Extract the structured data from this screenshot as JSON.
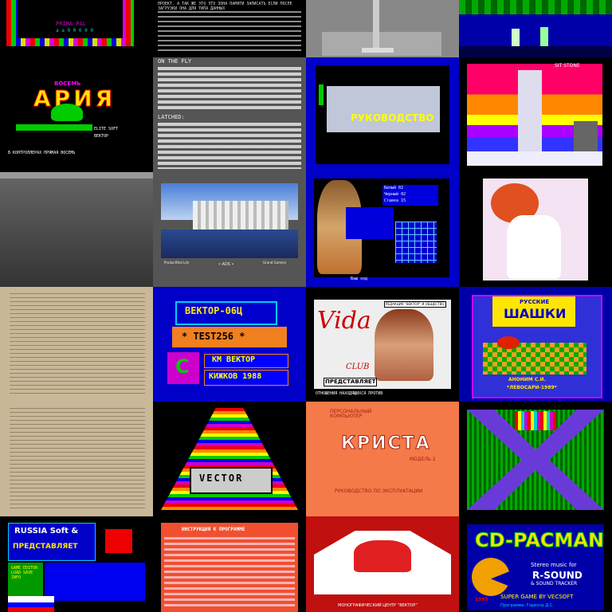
{
  "tiles": {
    "r0c0": {
      "line1": "PRIMA PAL",
      "line2": "a a 0 0 0 0 0"
    },
    "r0c1": {
      "text": "ПРОЕКТ. А ТАК ЖЕ ЭТО ЭТО ЗОНА ПАМЯТИ ЗАПИСАТЬ ЕСЛИ ПОСЛЕ ЗАГРУЗКИ ОНА ДЛЯ ТИПА ДАННЫХ"
    },
    "r1c0": {
      "top": "ВОСЕМЬ",
      "title": "АРИЯ",
      "sub1": "ELITE SOFT",
      "sub2": "ВЕКТОР",
      "bottom": "В КОНТРОЛЛЕРАХ ПРЯМАЯ ВОСЕМЬ"
    },
    "r1c1": {
      "header": "ON THE FLY",
      "latched": "LATCHED:"
    },
    "r1c2": {
      "caption": "РУКОВОДСТВО"
    },
    "r1c3": {
      "label": "SIT STONE"
    },
    "r2c2": {
      "score1": "Белый 02",
      "score2": "Черный 02",
      "score3": "Ставка 15",
      "footer": "Ваш ход"
    },
    "r2c1": {
      "credit1": "ProductRed Ldn",
      "credit2": "• ADS •",
      "credit3": "Grand Gamers"
    },
    "r3c1": {
      "title": "ВЕКТОР-06Ц",
      "test": "* TEST256 *",
      "logo": "С",
      "team": "KM ВЕКТОР",
      "year": "КИЖКОВ 1988"
    },
    "r3c2": {
      "brand": "Vida",
      "club": "CLUB",
      "box": "РЕДАКЦИЯ “ВЕКТОР” И ОБЩЕСТВО",
      "presents": "ПРЕДСТАВЛЯЕТ",
      "footer": "ОТНОШЕНИЯ НАХОДЯЩИХСЯ ПРОТИВ"
    },
    "r3c3": {
      "title1": "РУССКИЕ",
      "title2": "ШАШКИ",
      "author": "АНОНИМ С.И.",
      "year": "*ЛЕВОСАРИ-1989*"
    },
    "r4c1": {
      "label": "VECTOR"
    },
    "r4c2": {
      "top": "ПЕРСОНАЛЬНЫЙ КОМПЬЮТЕР",
      "brand": "КРИСТА",
      "model": "МОДЕЛЬ 2",
      "sub": "РУКОВОДСТВО ПО ЭКСПЛУАТАЦИИ"
    },
    "r5c0": {
      "line1": "RUSSIA Soft &",
      "line2": "ПРЕДСТАВЛЯЕТ",
      "menu": "GAME EDITOR LOAD SAVE INFO"
    },
    "r5c1": {
      "line1": "ИНСТРУКЦИЯ К ПРОГРАММЕ"
    },
    "r5c2": {
      "footer": "МОНОГРАФИЧЕСКИЙ ЦЕНТР “ВЕКТОР”"
    },
    "r5c3": {
      "title": "CD-PACMAN",
      "line1": "Stereo music for",
      "line2": "R-SOUND",
      "line3": "& SOUND TRACKER",
      "line4": "SUPER GAME BY VECSOFT",
      "year": "1995",
      "credit": "Программа: Горилла Д.С."
    }
  },
  "colors": {
    "black": "#000000",
    "blue": "#0000c8",
    "yellow": "#ffe600",
    "green": "#00c800",
    "red": "#e02000",
    "cyan": "#00c8d8",
    "magenta": "#d800d8",
    "white": "#ffffff",
    "orange": "#f47a4a",
    "paper": "#c8b898"
  }
}
